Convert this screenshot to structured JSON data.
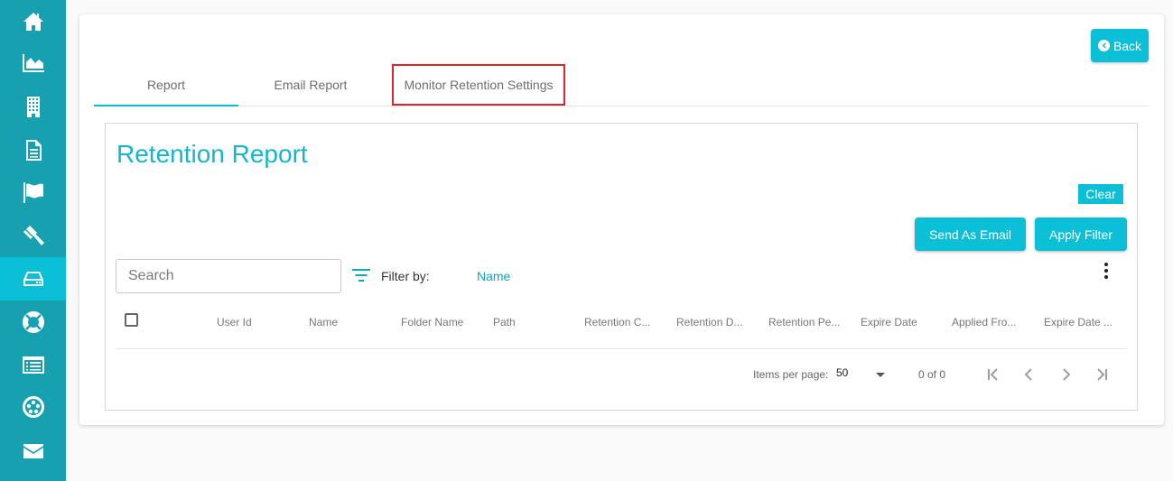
{
  "sidebar": {
    "items": [
      {
        "icon": "home-icon"
      },
      {
        "icon": "area-chart-icon"
      },
      {
        "icon": "building-icon"
      },
      {
        "icon": "document-icon"
      },
      {
        "icon": "flag-icon"
      },
      {
        "icon": "gavel-icon"
      },
      {
        "icon": "storage-drive-icon",
        "active": true
      },
      {
        "icon": "life-ring-icon"
      },
      {
        "icon": "list-icon"
      },
      {
        "icon": "network-icon"
      },
      {
        "icon": "envelope-icon"
      }
    ]
  },
  "header": {
    "back_label": "Back"
  },
  "tabs": [
    {
      "label": "Report",
      "active": true
    },
    {
      "label": "Email Report"
    },
    {
      "label": "Monitor Retention Settings",
      "highlighted": true
    }
  ],
  "report": {
    "title": "Retention Report",
    "clear_label": "Clear",
    "send_email_label": "Send As Email",
    "apply_filter_label": "Apply Filter",
    "search_placeholder": "Search",
    "filter_by_label": "Filter by:",
    "filter_field": "Name",
    "columns": [
      "User Id",
      "Name",
      "Folder Name",
      "Path",
      "Retention C...",
      "Retention D...",
      "Retention Pe...",
      "Expire Date",
      "Applied Fro...",
      "Expire Date ..."
    ]
  },
  "pagination": {
    "items_per_page_label": "Items per page:",
    "items_per_page": "50",
    "range": "0 of 0"
  },
  "colors": {
    "sidebar": "#17a0b0",
    "accent": "#0bbfd6",
    "highlight_border": "#d9262c"
  }
}
